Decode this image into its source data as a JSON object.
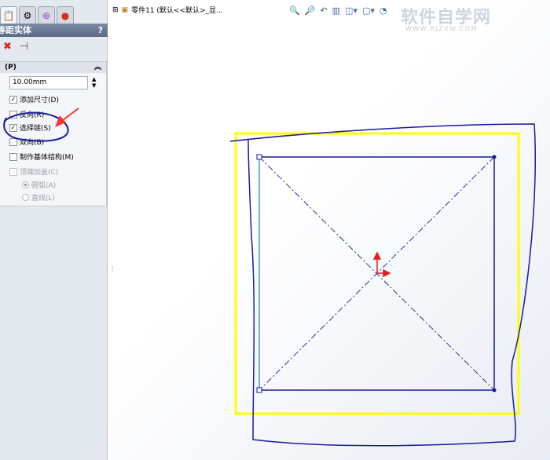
{
  "panel": {
    "title": "等距实体",
    "help": "?",
    "group_header": "(P)",
    "distance": "10.00mm",
    "options": [
      {
        "label": "添加尺寸(D)",
        "checked": true
      },
      {
        "label": "反向(R)",
        "checked": false
      },
      {
        "label": "选择链(S)",
        "checked": true
      },
      {
        "label": "双向(B)",
        "checked": false
      },
      {
        "label": "制作基体结构(M)",
        "checked": false
      }
    ],
    "cap": {
      "label": "顶端加盖(C)",
      "radios": [
        "圆弧(A)",
        "直线(L)"
      ]
    }
  },
  "tree": {
    "expand": "⊞",
    "label": "零件11  (默认<<默认>_显..."
  },
  "watermark": {
    "main": "软件自学网",
    "url": "WWW.RJZXW.COM"
  },
  "colors": {
    "sketch": "#1a1a8c",
    "offset": "#ffff00",
    "annotation": "#1a1aa0",
    "arrow": "#ff3030"
  }
}
